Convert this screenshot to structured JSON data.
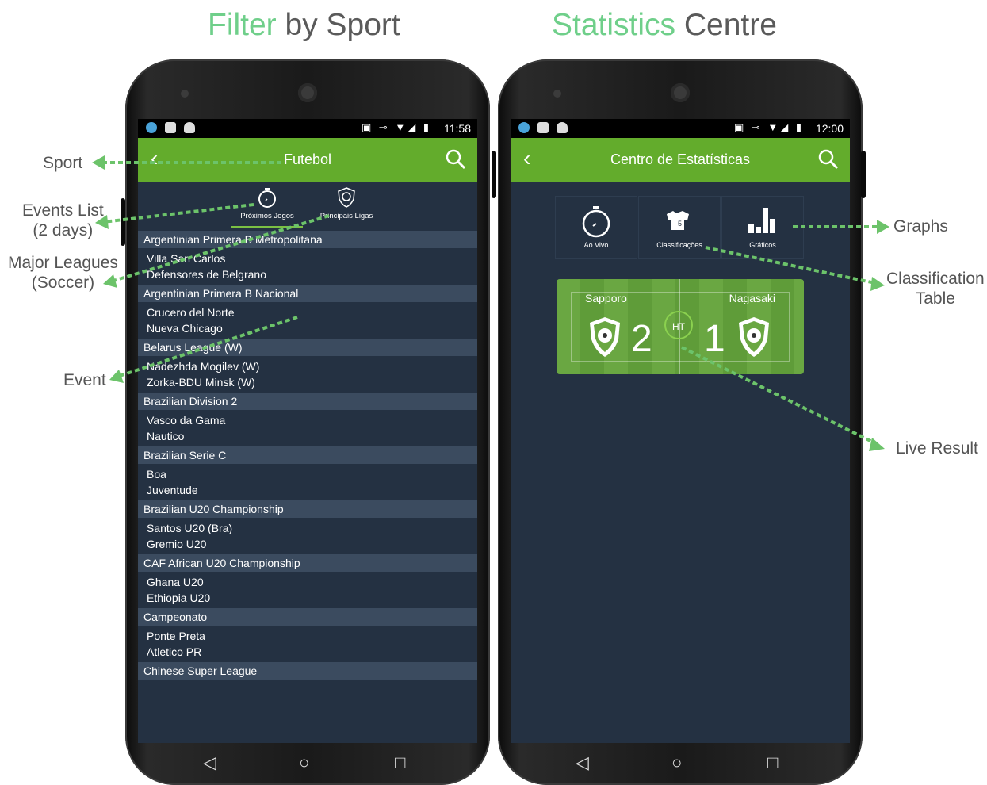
{
  "headings": {
    "left": {
      "highlight": "Filter",
      "rest": " by Sport"
    },
    "right": {
      "highlight": "Statistics",
      "rest": " Centre"
    }
  },
  "annotations": {
    "sport": "Sport",
    "events_list_line1": "Events List",
    "events_list_line2": "(2 days)",
    "major_leagues_line1": "Major Leagues",
    "major_leagues_line2": "(Soccer)",
    "event": "Event",
    "graphs": "Graphs",
    "classification_line1": "Classification",
    "classification_line2": "Table",
    "live_result": "Live Result"
  },
  "colors": {
    "accent_green": "#63ac2c",
    "screen_bg": "#243142",
    "league_row": "#3b4b5f",
    "annotation_arrow": "#6cc36a"
  },
  "left_phone": {
    "status_time": "11:58",
    "title": "Futebol",
    "tabs": [
      {
        "label": "Próximos Jogos",
        "icon": "stopwatch-icon",
        "active": true
      },
      {
        "label": "Principais Ligas",
        "icon": "shield-ball-icon",
        "active": false
      }
    ],
    "events": [
      {
        "league": "Argentinian Primera B Metropolitana",
        "home": "Villa San Carlos",
        "away": "Defensores de Belgrano"
      },
      {
        "league": "Argentinian Primera B Nacional",
        "home": "Crucero del Norte",
        "away": "Nueva Chicago"
      },
      {
        "league": "Belarus League (W)",
        "home": "Nadezhda Mogilev (W)",
        "away": "Zorka-BDU Minsk (W)"
      },
      {
        "league": "Brazilian Division 2",
        "home": "Vasco da Gama",
        "away": "Nautico"
      },
      {
        "league": "Brazilian Serie C",
        "home": "Boa",
        "away": "Juventude"
      },
      {
        "league": "Brazilian U20 Championship",
        "home": "Santos U20 (Bra)",
        "away": "Gremio U20"
      },
      {
        "league": "CAF African U20 Championship",
        "home": "Ghana U20",
        "away": "Ethiopia U20"
      },
      {
        "league": "Campeonato",
        "home": "Ponte Preta",
        "away": "Atletico PR"
      },
      {
        "league": "Chinese Super League",
        "home": "",
        "away": ""
      }
    ]
  },
  "right_phone": {
    "status_time": "12:00",
    "title": "Centro de Estatísticas",
    "menu": [
      {
        "label": "Ao Vivo",
        "icon": "stopwatch-icon"
      },
      {
        "label": "Classificações",
        "icon": "jerseys-icon"
      },
      {
        "label": "Gráficos",
        "icon": "bar-chart-icon"
      }
    ],
    "live": {
      "home_team": "Sapporo",
      "away_team": "Nagasaki",
      "home_score": "2",
      "away_score": "1",
      "period": "HT"
    }
  }
}
